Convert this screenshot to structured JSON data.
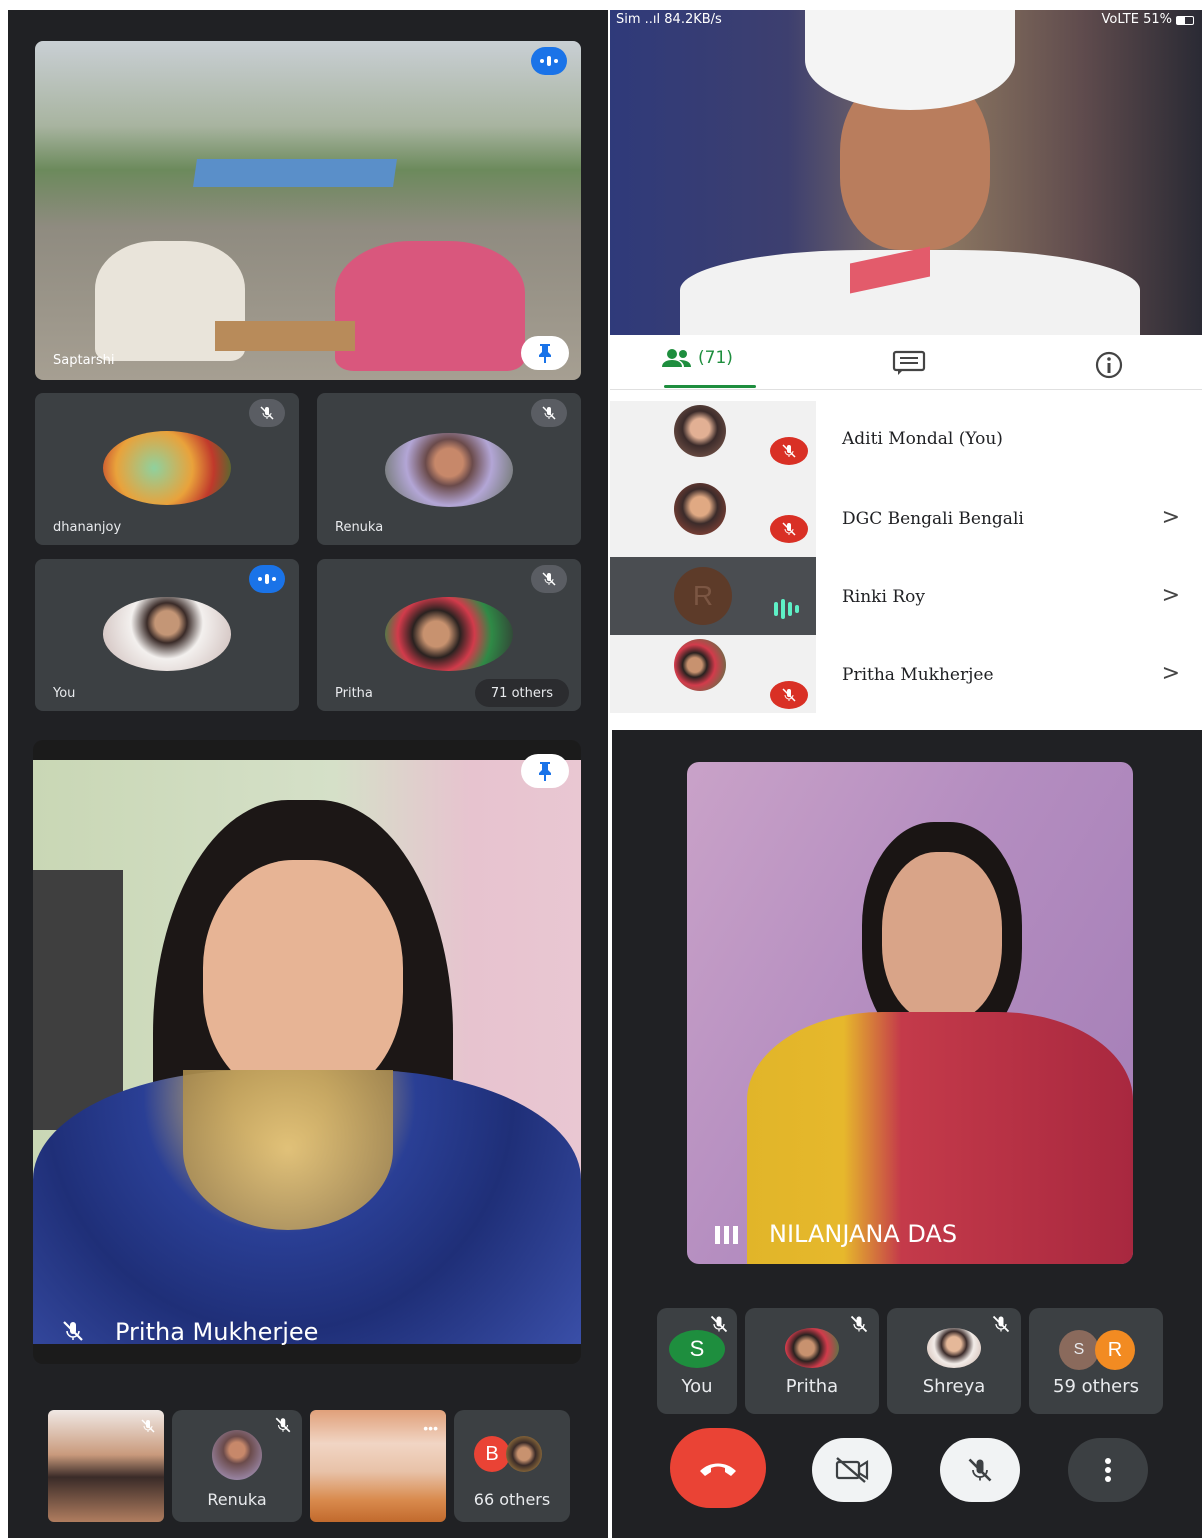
{
  "panel_tl": {
    "main_tile_name": "Saptarshi",
    "tiles": [
      {
        "name": "dhananjoy"
      },
      {
        "name": "Renuka"
      },
      {
        "name": "You"
      },
      {
        "name": "Pritha"
      }
    ],
    "others_chip": "71 others"
  },
  "panel_tr": {
    "status_bar": {
      "left": "Sim ..ıl 84.2KB/s",
      "right": "VoLTE 51%"
    },
    "tabs": {
      "people_count": "(71)"
    },
    "participants": [
      {
        "name": "Aditi Mondal (You)",
        "avatar_initial": ""
      },
      {
        "name": "DGC Bengali Bengali",
        "avatar_initial": ""
      },
      {
        "name": "Rinki Roy",
        "avatar_initial": "R"
      },
      {
        "name": "Pritha Mukherjee",
        "avatar_initial": ""
      }
    ]
  },
  "panel_bl": {
    "main_name": "Pritha Mukherjee",
    "strip": [
      {
        "label": ""
      },
      {
        "label": "Renuka"
      },
      {
        "label": ""
      },
      {
        "label": "66 others",
        "initial": "B"
      }
    ]
  },
  "panel_br": {
    "speaker_name": "NILANJANA DAS",
    "strip": [
      {
        "label": "You",
        "initial": "S"
      },
      {
        "label": "Pritha"
      },
      {
        "label": "Shreya"
      },
      {
        "label": "59 others",
        "initial_a": "S",
        "initial_b": "R"
      }
    ]
  },
  "colors": {
    "meet_dark": "#202124",
    "tile_grey": "#3c4043",
    "meet_blue": "#1a73e8",
    "mute_red": "#d93025",
    "end_call_red": "#ea4335",
    "meet_green": "#1e8e3e"
  }
}
